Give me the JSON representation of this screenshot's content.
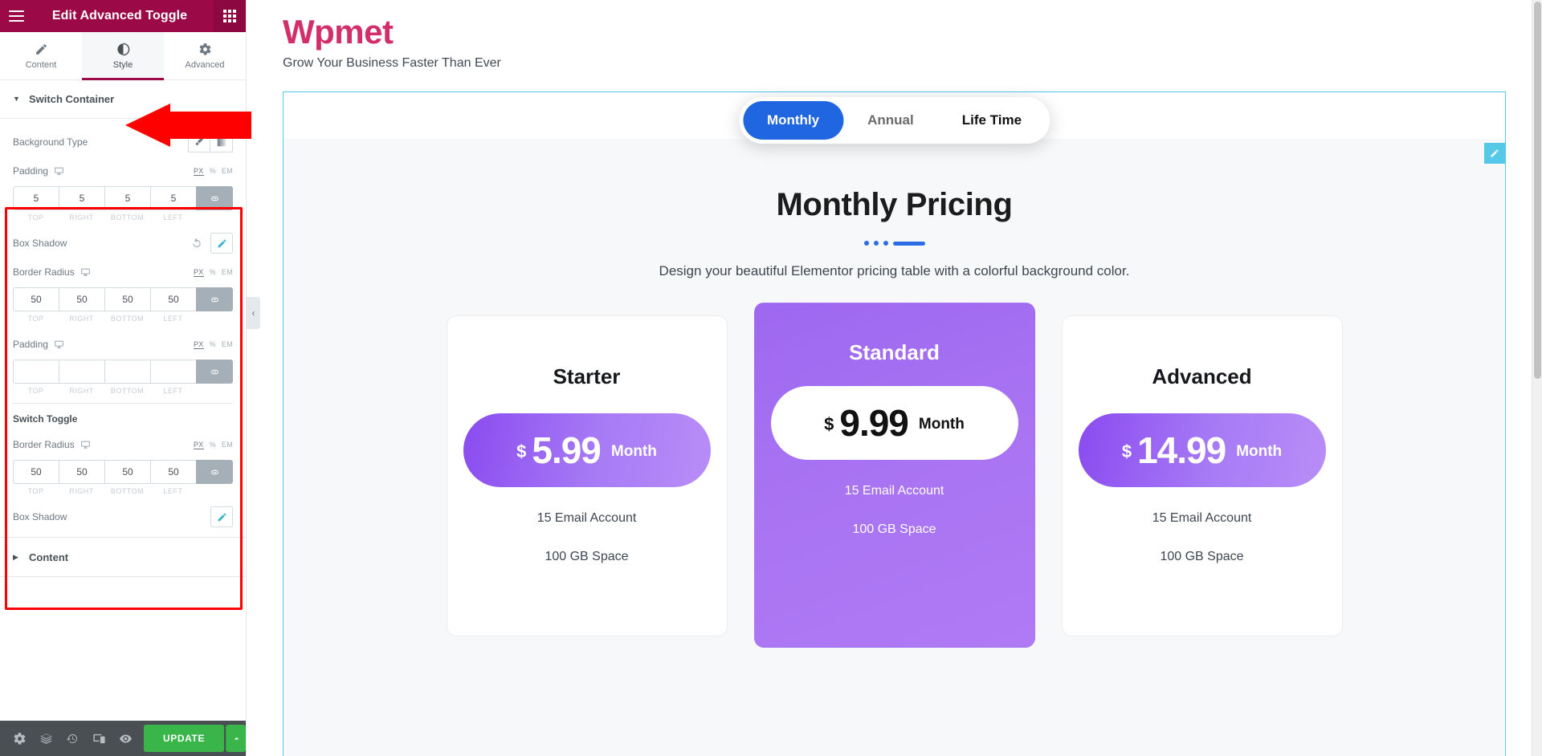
{
  "panel": {
    "header": {
      "title": "Edit Advanced Toggle",
      "menu_icon": "hamburger-icon",
      "apps_icon": "grid-apps-icon"
    },
    "tabs": [
      {
        "label": "Content",
        "icon": "pencil-icon",
        "active": false
      },
      {
        "label": "Style",
        "icon": "half-circle-contrast-icon",
        "active": true
      },
      {
        "label": "Advanced",
        "icon": "gear-icon",
        "active": false
      }
    ],
    "sections": [
      {
        "title": "Switch Container",
        "expanded": true,
        "controls": [
          {
            "type": "background-type",
            "label": "Background Type",
            "options": [
              {
                "name": "classic",
                "icon": "paint-brush-icon"
              },
              {
                "name": "gradient",
                "icon": "gradient-icon"
              }
            ]
          },
          {
            "type": "dimensions",
            "label": "Padding",
            "device": "desktop-icon",
            "units": [
              "PX",
              "%",
              "EM"
            ],
            "active_unit": "PX",
            "values": [
              "5",
              "5",
              "5",
              "5"
            ],
            "sides": [
              "TOP",
              "RIGHT",
              "BOTTOM",
              "LEFT"
            ],
            "linked": true
          },
          {
            "type": "popover",
            "label": "Box Shadow",
            "has_reset": true,
            "edit_icon": "pencil-icon"
          },
          {
            "type": "dimensions",
            "label": "Border Radius",
            "device": "desktop-icon",
            "units": [
              "PX",
              "%",
              "EM"
            ],
            "active_unit": "PX",
            "values": [
              "50",
              "50",
              "50",
              "50"
            ],
            "sides": [
              "TOP",
              "RIGHT",
              "BOTTOM",
              "LEFT"
            ],
            "linked": true
          },
          {
            "type": "dimensions",
            "label": "Padding",
            "device": "desktop-icon",
            "units": [
              "PX",
              "%",
              "EM"
            ],
            "active_unit": "PX",
            "values": [
              "",
              "",
              "",
              ""
            ],
            "sides": [
              "TOP",
              "RIGHT",
              "BOTTOM",
              "LEFT"
            ],
            "linked": true
          }
        ],
        "subsection": {
          "title": "Switch Toggle",
          "controls": [
            {
              "type": "dimensions",
              "label": "Border Radius",
              "device": "desktop-icon",
              "units": [
                "PX",
                "%",
                "EM"
              ],
              "active_unit": "PX",
              "values": [
                "50",
                "50",
                "50",
                "50"
              ],
              "sides": [
                "TOP",
                "RIGHT",
                "BOTTOM",
                "LEFT"
              ],
              "linked": true
            },
            {
              "type": "popover",
              "label": "Box Shadow",
              "has_reset": false,
              "edit_icon": "pencil-icon"
            }
          ]
        }
      },
      {
        "title": "Content",
        "expanded": false
      }
    ],
    "footer": {
      "icons": [
        {
          "name": "settings-gear-icon"
        },
        {
          "name": "navigator-layers-icon"
        },
        {
          "name": "history-clock-icon"
        },
        {
          "name": "responsive-devices-icon"
        },
        {
          "name": "preview-eye-icon"
        }
      ],
      "update_label": "UPDATE",
      "update_caret_icon": "chevron-up-icon"
    },
    "collapse_handle_icon": "chevron-left-icon",
    "highlight_color": "#fe0000",
    "header_color": "#9b0a46",
    "update_color": "#39b54a"
  },
  "preview": {
    "brand": "Wpmet",
    "brand_color": "#d22e68",
    "tagline": "Grow Your Business Faster Than Ever",
    "edit_handle_icon": "pencil-icon",
    "switch": {
      "items": [
        {
          "label": "Monthly",
          "state": "active"
        },
        {
          "label": "Annual",
          "state": "muted"
        },
        {
          "label": "Life Time",
          "state": "dark"
        }
      ],
      "active_color": "#1f66e0"
    },
    "pricing": {
      "title": "Monthly Pricing",
      "subtitle": "Design your beautiful Elementor pricing table with a colorful background color.",
      "accent_color": "#2b6de5",
      "cards": [
        {
          "name": "Starter",
          "currency": "$",
          "amount": "5.99",
          "period": "Month",
          "featured": false,
          "features": [
            "15 Email Account",
            "100 GB Space"
          ]
        },
        {
          "name": "Standard",
          "currency": "$",
          "amount": "9.99",
          "period": "Month",
          "featured": true,
          "features": [
            "15 Email Account",
            "100 GB Space"
          ]
        },
        {
          "name": "Advanced",
          "currency": "$",
          "amount": "14.99",
          "period": "Month",
          "featured": false,
          "features": [
            "15 Email Account",
            "100 GB Space"
          ]
        }
      ]
    }
  }
}
